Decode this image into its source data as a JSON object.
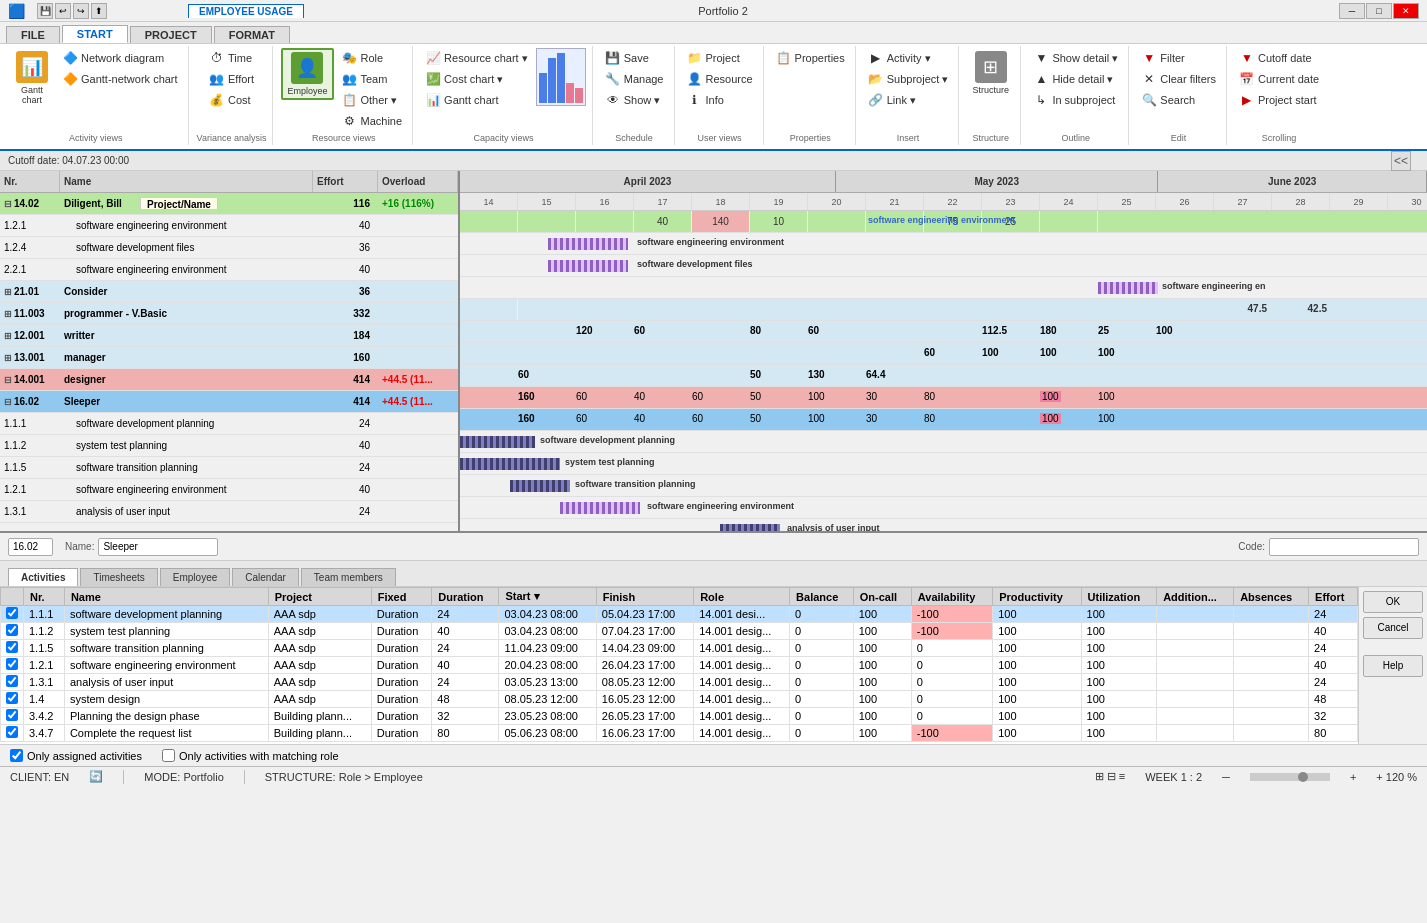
{
  "titlebar": {
    "app_icons": [
      "💾",
      "↩",
      "↪",
      "⬆"
    ],
    "tab_active": "EMPLOYEE USAGE",
    "title": "Portfolio 2",
    "win_btns": [
      "─",
      "□",
      "✕"
    ]
  },
  "ribbon_tabs": [
    "FILE",
    "START",
    "PROJECT",
    "FORMAT"
  ],
  "ribbon_tab_active": "START",
  "ribbon_groups": {
    "activity_views": {
      "label": "Activity views",
      "buttons": [
        "Gantt chart",
        "Network diagram",
        "Gantt-network chart"
      ]
    },
    "variance_analysis": {
      "label": "Variance analysis",
      "buttons": [
        "Time",
        "Effort",
        "Cost"
      ]
    },
    "resource_views": {
      "label": "Resource views",
      "buttons": [
        "Role",
        "Team",
        "Other",
        "Employee",
        "Machine"
      ]
    },
    "capacity_views": {
      "label": "Capacity views",
      "buttons": [
        "Resource chart",
        "Cost chart",
        "Gantt chart"
      ]
    },
    "schedule": {
      "label": "Schedule",
      "buttons": [
        "Save",
        "Manage",
        "Show"
      ]
    },
    "user_views": {
      "label": "User views",
      "buttons": [
        "Project",
        "Resource",
        "Info"
      ]
    },
    "properties": {
      "label": "Properties",
      "buttons": [
        "Properties"
      ]
    },
    "insert": {
      "label": "Insert",
      "buttons": [
        "Activity",
        "Subproject",
        "Link"
      ]
    },
    "structure": {
      "label": "Structure",
      "btn": "Structure"
    },
    "outline": {
      "label": "Outline",
      "buttons": [
        "Show detail",
        "Hide detail",
        "In subproject"
      ]
    },
    "edit": {
      "label": "Edit",
      "buttons": [
        "Filter",
        "Clear filters",
        "Search"
      ]
    },
    "scrolling": {
      "label": "Scrolling",
      "buttons": [
        "Cutoff date",
        "Current date",
        "Project start"
      ]
    }
  },
  "gantt": {
    "cutoff_date": "Cutoff date: 04.07.23 00:00",
    "months": [
      "April 2023",
      "May 2023",
      "June 2023"
    ],
    "days": [
      "14",
      "15",
      "16",
      "17",
      "18",
      "19",
      "20",
      "21",
      "22",
      "23",
      "24"
    ],
    "col_headers": [
      "Nr.",
      "Name",
      "Effort",
      "Overload"
    ],
    "rows": [
      {
        "nr": "14.02",
        "name": "Diligent, Bill",
        "effort": "116",
        "overload": "+16 (116%)",
        "type": "group",
        "expanded": true,
        "highlight": "green"
      },
      {
        "nr": "1.2.1",
        "name": "software engineering environment",
        "effort": "40",
        "overload": "",
        "type": "task",
        "indent": 1
      },
      {
        "nr": "1.2.4",
        "name": "software development files",
        "effort": "36",
        "overload": "",
        "type": "task",
        "indent": 1
      },
      {
        "nr": "2.2.1",
        "name": "software engineering environment",
        "effort": "40",
        "overload": "",
        "type": "task",
        "indent": 1
      },
      {
        "nr": "21.01",
        "name": "Consider",
        "effort": "36",
        "overload": "",
        "type": "group",
        "indent": 0
      },
      {
        "nr": "11.003",
        "name": "programmer - V.Basic",
        "effort": "332",
        "overload": "",
        "type": "group",
        "indent": 0
      },
      {
        "nr": "12.001",
        "name": "writter",
        "effort": "184",
        "overload": "",
        "type": "group",
        "indent": 0
      },
      {
        "nr": "13.001",
        "name": "manager",
        "effort": "160",
        "overload": "",
        "type": "group",
        "indent": 0
      },
      {
        "nr": "14.001",
        "name": "designer",
        "effort": "414",
        "overload": "+44.5 (11...",
        "type": "group",
        "indent": 0,
        "highlight": "pink"
      },
      {
        "nr": "16.02",
        "name": "Sleeper",
        "effort": "414",
        "overload": "+44.5 (11...",
        "type": "group",
        "expanded": true,
        "highlight": "selected"
      },
      {
        "nr": "1.1.1",
        "name": "software development planning",
        "effort": "24",
        "overload": "",
        "type": "task",
        "indent": 1
      },
      {
        "nr": "1.1.2",
        "name": "system test planning",
        "effort": "40",
        "overload": "",
        "type": "task",
        "indent": 1
      },
      {
        "nr": "1.1.5",
        "name": "software transition planning",
        "effort": "24",
        "overload": "",
        "type": "task",
        "indent": 1
      },
      {
        "nr": "1.2.1",
        "name": "software engineering environment",
        "effort": "40",
        "overload": "",
        "type": "task",
        "indent": 1
      },
      {
        "nr": "1.3.1",
        "name": "analysis of user input",
        "effort": "24",
        "overload": "",
        "type": "task",
        "indent": 1
      }
    ],
    "chart_values": {
      "row0": [
        {
          "col": 3,
          "val": "40"
        },
        {
          "col": 4,
          "val": "140",
          "highlight": "pink"
        },
        {
          "col": 5,
          "val": "10"
        },
        {
          "col": 8,
          "val": "75"
        },
        {
          "col": 9,
          "val": "25"
        }
      ],
      "row4": [
        {
          "col": 9,
          "val": "47.5"
        },
        {
          "col": 10,
          "val": "42.5"
        }
      ],
      "row5": [
        {
          "col": 2,
          "val": "120"
        },
        {
          "col": 3,
          "val": "60"
        },
        {
          "col": 5,
          "val": "80"
        },
        {
          "col": 6,
          "val": "60"
        },
        {
          "col": 8,
          "val": "112.5"
        },
        {
          "col": 9,
          "val": "180"
        },
        {
          "col": 10,
          "val": "25"
        },
        {
          "col": 11,
          "val": "100"
        }
      ],
      "row6": [
        {
          "col": 8,
          "val": "60"
        },
        {
          "col": 9,
          "val": "100"
        },
        {
          "col": 10,
          "val": "100"
        },
        {
          "col": 11,
          "val": "100"
        }
      ],
      "row7": [
        {
          "col": 1,
          "val": "60"
        },
        {
          "col": 5,
          "val": "50"
        },
        {
          "col": 6,
          "val": "130"
        },
        {
          "col": 7,
          "val": "64.4"
        }
      ],
      "row8": [
        {
          "col": 1,
          "val": "160"
        },
        {
          "col": 2,
          "val": "60"
        },
        {
          "col": 3,
          "val": "40"
        },
        {
          "col": 4,
          "val": "60"
        },
        {
          "col": 5,
          "val": "50"
        },
        {
          "col": 6,
          "val": "100"
        },
        {
          "col": 7,
          "val": "30"
        },
        {
          "col": 8,
          "val": "80"
        },
        {
          "col": 10,
          "val": "100",
          "highlight": "pink"
        },
        {
          "col": 11,
          "val": "100"
        }
      ],
      "row9": [
        {
          "col": 1,
          "val": "160"
        },
        {
          "col": 2,
          "val": "60"
        },
        {
          "col": 3,
          "val": "40"
        },
        {
          "col": 4,
          "val": "60"
        },
        {
          "col": 5,
          "val": "50"
        },
        {
          "col": 6,
          "val": "100"
        },
        {
          "col": 7,
          "val": "30"
        },
        {
          "col": 8,
          "val": "80"
        },
        {
          "col": 10,
          "val": "100",
          "highlight": "pink"
        },
        {
          "col": 11,
          "val": "100"
        }
      ]
    }
  },
  "bottom_panel": {
    "id_field": "16.02",
    "name_label": "Name:",
    "name_value": "Sleeper",
    "code_label": "Code:",
    "code_value": "",
    "tabs": [
      "Activities",
      "Timesheets",
      "Employee",
      "Calendar",
      "Team members"
    ],
    "active_tab": "Activities",
    "table_headers": [
      "Nr.",
      "Name",
      "Project",
      "Fixed",
      "Duration",
      "Start",
      "Finish",
      "Role",
      "Balance",
      "On-call",
      "Availability",
      "Productivity",
      "Utilization",
      "Addition...",
      "Absences",
      "Effort"
    ],
    "table_rows": [
      {
        "nr": "1.1.1",
        "name": "software development planning",
        "project": "AAA sdp",
        "fixed": "Duration",
        "duration": "24",
        "start": "03.04.23 08:00",
        "finish": "05.04.23 17:00",
        "role": "14.001 desi...",
        "balance": "0",
        "oncall": "100",
        "avail": "-100",
        "prod": "100",
        "util": "100",
        "add": "",
        "abs": "",
        "effort": "24",
        "avail_red": true
      },
      {
        "nr": "1.1.2",
        "name": "system test planning",
        "project": "AAA sdp",
        "fixed": "Duration",
        "duration": "40",
        "start": "03.04.23 08:00",
        "finish": "07.04.23 17:00",
        "role": "14.001 desig...",
        "balance": "0",
        "oncall": "100",
        "avail": "-100",
        "prod": "100",
        "util": "100",
        "add": "",
        "abs": "",
        "effort": "40",
        "avail_red": true
      },
      {
        "nr": "1.1.5",
        "name": "software transition planning",
        "project": "AAA sdp",
        "fixed": "Duration",
        "duration": "24",
        "start": "11.04.23 09:00",
        "finish": "14.04.23 09:00",
        "role": "14.001 desig...",
        "balance": "0",
        "oncall": "100",
        "avail": "0",
        "prod": "100",
        "util": "100",
        "add": "",
        "abs": "",
        "effort": "24"
      },
      {
        "nr": "1.2.1",
        "name": "software engineering environment",
        "project": "AAA sdp",
        "fixed": "Duration",
        "duration": "40",
        "start": "20.04.23 08:00",
        "finish": "26.04.23 17:00",
        "role": "14.001 desig...",
        "balance": "0",
        "oncall": "100",
        "avail": "0",
        "prod": "100",
        "util": "100",
        "add": "",
        "abs": "",
        "effort": "40"
      },
      {
        "nr": "1.3.1",
        "name": "analysis of user input",
        "project": "AAA sdp",
        "fixed": "Duration",
        "duration": "24",
        "start": "03.05.23 13:00",
        "finish": "08.05.23 12:00",
        "role": "14.001 desig...",
        "balance": "0",
        "oncall": "100",
        "avail": "0",
        "prod": "100",
        "util": "100",
        "add": "",
        "abs": "",
        "effort": "24"
      },
      {
        "nr": "1.4",
        "name": "system design",
        "project": "AAA sdp",
        "fixed": "Duration",
        "duration": "48",
        "start": "08.05.23 12:00",
        "finish": "16.05.23 12:00",
        "role": "14.001 desig...",
        "balance": "0",
        "oncall": "100",
        "avail": "0",
        "prod": "100",
        "util": "100",
        "add": "",
        "abs": "",
        "effort": "48"
      },
      {
        "nr": "3.4.2",
        "name": "Planning the design phase",
        "project": "Building plann...",
        "fixed": "Duration",
        "duration": "32",
        "start": "23.05.23 08:00",
        "finish": "26.05.23 17:00",
        "role": "14.001 desig...",
        "balance": "0",
        "oncall": "100",
        "avail": "0",
        "prod": "100",
        "util": "100",
        "add": "",
        "abs": "",
        "effort": "32"
      },
      {
        "nr": "3.4.7",
        "name": "Complete the request list",
        "project": "Building plann...",
        "fixed": "Duration",
        "duration": "80",
        "start": "05.06.23 08:00",
        "finish": "16.06.23 17:00",
        "role": "14.001 desig...",
        "balance": "0",
        "oncall": "100",
        "avail": "-100",
        "prod": "100",
        "util": "100",
        "add": "",
        "abs": "",
        "effort": "80",
        "avail_red": true
      }
    ],
    "footer": {
      "only_assigned": "Only assigned activities",
      "only_matching": "Only activities with matching role"
    },
    "side_btns": [
      "OK",
      "Cancel",
      "Help"
    ]
  },
  "status_bar": {
    "client": "CLIENT: EN",
    "mode": "MODE: Portfolio",
    "structure": "STRUCTURE: Role > Employee",
    "week": "WEEK 1 : 2",
    "zoom": "+ 120 %"
  },
  "tooltip": "Project/Name"
}
